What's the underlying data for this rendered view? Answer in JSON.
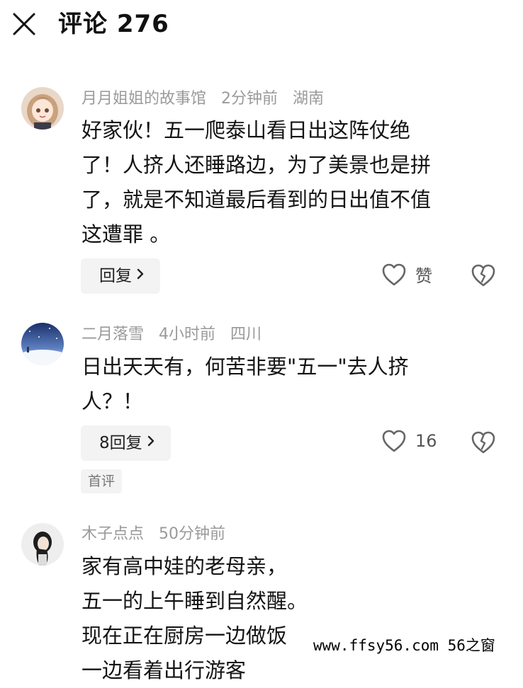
{
  "header": {
    "close_icon": "close-icon",
    "title": "评论 276"
  },
  "comments": [
    {
      "user": "月月姐姐的故事馆",
      "time": "2分钟前",
      "location": "湖南",
      "text": "好家伙！五一爬泰山看日出这阵仗绝\n了！人挤人还睡路边，为了美景也是拼\n了，就是不知道最后看到的日出值不值\n这遭罪 。",
      "reply_label": "回复",
      "like_label": "赞",
      "avatar_icon": "anime-girl-avatar"
    },
    {
      "user": "二月落雪",
      "time": "4小时前",
      "location": "四川",
      "text": "日出天天有，何苦非要\"五一\"去人挤\n人？！",
      "reply_label": "8回复",
      "like_label": "16",
      "badge": "首评",
      "avatar_icon": "snow-landscape-avatar"
    },
    {
      "user": "木子点点",
      "time": "50分钟前",
      "text": "家有高中娃的老母亲，\n五一的上午睡到自然醒。\n现在正在厨房一边做饭\n一边看着出行游客",
      "avatar_icon": "girl-portrait-avatar"
    }
  ],
  "watermark": "www.ffsy56.com 56之窗",
  "colors": {
    "meta_gray": "#9a9a9a",
    "button_bg": "#f3f3f3",
    "text": "#141414"
  }
}
